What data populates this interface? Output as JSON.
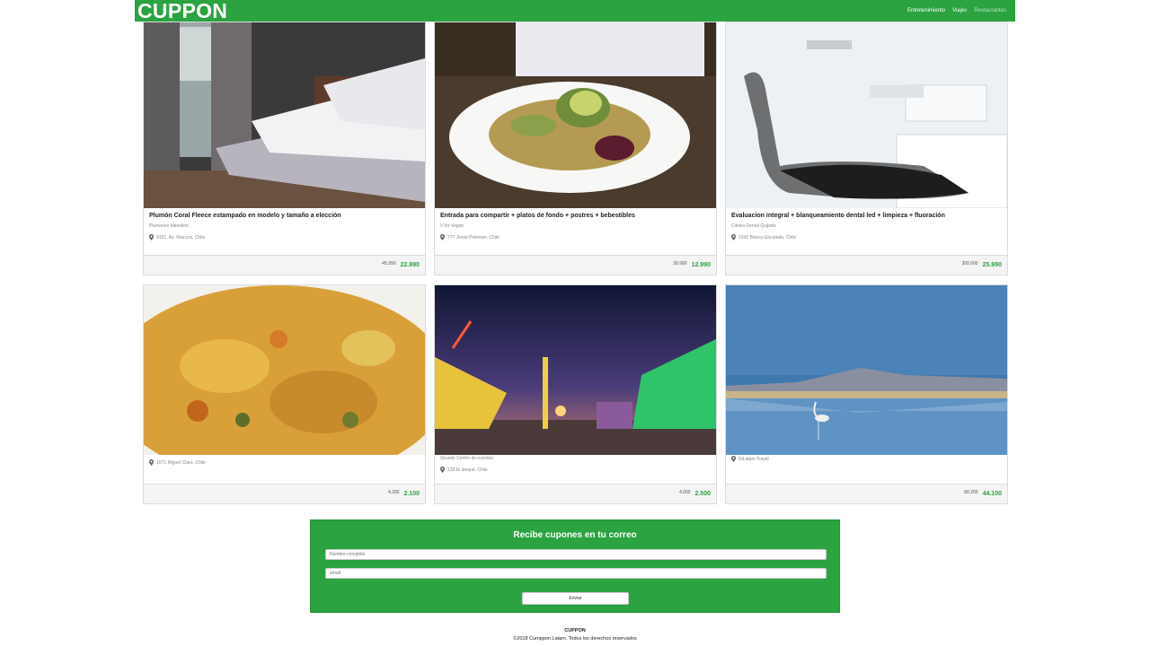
{
  "header": {
    "logo": "CUPPON",
    "nav": [
      "Entretenimiento",
      "Viajes",
      "Restaurantes"
    ]
  },
  "cards": [
    {
      "title": "Plumón Coral Fleece estampado en modelo y tamaño a elección",
      "company": "Plumones Manolino",
      "location": "9191, Av. Vitacura, Chile",
      "old_price": "45.990",
      "new_price": "22.990",
      "image": "bedroom"
    },
    {
      "title": "Entrada para compartir + platos de fondo + postres + bebestibles",
      "company": "V for Vegan",
      "location": "777 Jesse Pinkman, Chile",
      "old_price": "30.990",
      "new_price": "12.990",
      "image": "salad-plate"
    },
    {
      "title": "Evaluacion integral + blanqueamiento dental led + limpieza + fluoración",
      "company": "Clinica Dental Quijada",
      "location": "1342 Blanco Encalada, Chile",
      "old_price": "300.000",
      "new_price": "25.990",
      "image": "dental-chair"
    },
    {
      "title": "",
      "company": "",
      "location": "1071 Miguel Claro, Chile",
      "old_price": "4.200",
      "new_price": "2.100",
      "image": "scrambled-food"
    },
    {
      "title": "",
      "company": "Skunds Centro de eventos",
      "location": "133 El lanque, Chile",
      "old_price": "4.000",
      "new_price": "2.500",
      "image": "fair-rides"
    },
    {
      "title": "",
      "company": "",
      "location": "DiLatam Travel",
      "old_price": "80.200",
      "new_price": "44.100",
      "image": "flamingo-lake"
    }
  ],
  "newsletter": {
    "title": "Recibe cupones en tu correo",
    "name_placeholder": "Nombre completo",
    "email_placeholder": "email",
    "submit_label": "Enviar"
  },
  "footer": {
    "brand": "CUPPON",
    "copyright": "©2018 Cumppon Latam. Todos los derechos reservados"
  },
  "colors": {
    "brand_green": "#2aa340",
    "price_green": "#2aa340"
  }
}
